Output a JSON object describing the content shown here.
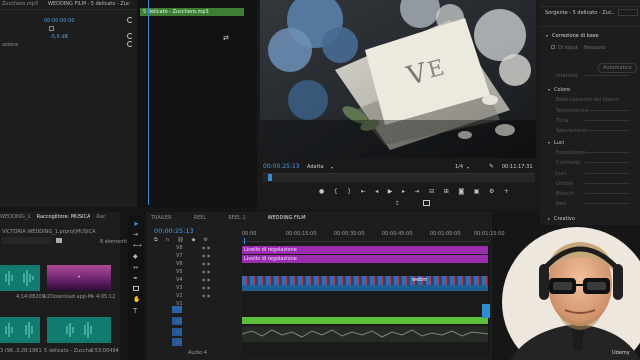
{
  "source": {
    "tab_clip": "WEDDING FILM : 5 delicato - Zucch...",
    "tab_file": "Zucchero.mp3",
    "row_a": "azione",
    "timecode": "00:00:00:00",
    "row_b_value": "‐5,6 dB"
  },
  "source_timeline": {
    "clip_label": "5 delicato - Zucchero.mp3"
  },
  "program": {
    "timecode": "00:00:25:13",
    "fit": "Adatta",
    "quality": "1/4",
    "duration": "00:11:17:31"
  },
  "lumetri": {
    "source_label": "Sorgente - 5 delicato - Zuc...",
    "section_base": "Correzione di base",
    "lut_label": "Di input",
    "lut_value": "Nessuno",
    "intensity_label": "Intensità",
    "auto_button": "Automatico",
    "section_color": "Colore",
    "white_balance": "Bilanciamento del bianco",
    "temperature": "Temperatura",
    "tint": "Tinta",
    "saturation": "Saturazione",
    "section_light": "Luci",
    "exposure": "Esposizione",
    "contrast": "Contrasto",
    "highlights": "Luci",
    "shadows": "Ombre",
    "whites": "Bianchi",
    "blacks": "Neri",
    "section_creative": "Creativo"
  },
  "project": {
    "tabs": [
      "WEDDING_1",
      "Raccoglitore: MUSICA",
      "Rac"
    ],
    "path": "VICTORIA WEDDING_1.prproj\\MUSICA",
    "item_count": "8 elementi",
    "items": [
      {
        "name": "4 4 MB209",
        "duration": "4:14:08209",
        "kind": "audio"
      },
      {
        "name": "k2Download app-Meri...",
        "duration": "4:05:12",
        "kind": "video"
      },
      {
        "name": "3 (96...",
        "duration": "3:28:1961",
        "kind": "audio"
      },
      {
        "name": "5 delicato - Zuccha...",
        "duration": "3:53:00494",
        "kind": "audio"
      }
    ]
  },
  "timeline": {
    "tabs": [
      "TRAILER",
      "REEL",
      "REEL 1",
      "WEDDING FILM"
    ],
    "timecode": "00:00:25:13",
    "ruler": [
      "00:00",
      "00:00:15:00",
      "00:00:30:00",
      "00:00:45:00",
      "00:01:00:00",
      "00:01:15:00"
    ],
    "video_tracks": [
      "V8",
      "V7",
      "V6",
      "V5",
      "V4",
      "V3",
      "V2",
      "V1"
    ],
    "audio_tracks": [
      "A1",
      "A2",
      "A3"
    ],
    "audio_label": "Audio 4",
    "clip1": "Livello di regolazione",
    "clip2": "Livello di regolazione",
    "clip3": "webm"
  },
  "watermark": "Udemy"
}
